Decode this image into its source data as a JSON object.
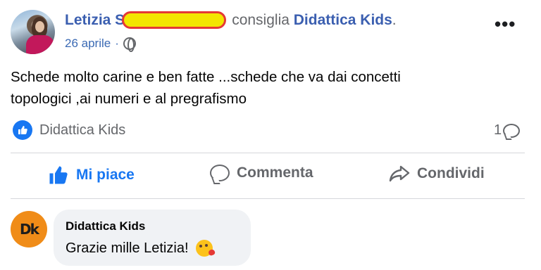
{
  "post": {
    "author_name": "Letizia S",
    "verb": "consiglia",
    "page_name": "Didattica Kids",
    "trailing_dot": ".",
    "date": "26 aprile",
    "meta_separator": "·",
    "privacy_icon": "globe-icon",
    "more_label": "•••",
    "text_line1": "Schede molto carine e ben fatte ...schede che va  dai concetti",
    "text_line2": "topologici ,ai numeri e al pregrafismo"
  },
  "reactions": {
    "recommended_page": "Didattica Kids",
    "reaction_icon": "like-icon",
    "comment_count": "1",
    "comment_icon": "comment-icon"
  },
  "actions": {
    "like_label": "Mi piace",
    "comment_label": "Commenta",
    "share_label": "Condividi"
  },
  "comment": {
    "avatar_text": "Dk",
    "author": "Didattica Kids",
    "text": "Grazie mille Letizia!",
    "emoji_icon": "kissing-face-icon"
  },
  "colors": {
    "link_blue": "#3b5fb0",
    "like_blue": "#1877f2",
    "muted_gray": "#65676b",
    "redaction_fill": "#f3e600",
    "redaction_border": "#e53935",
    "dk_orange": "#f08c18",
    "comment_bg": "#f0f2f5"
  }
}
